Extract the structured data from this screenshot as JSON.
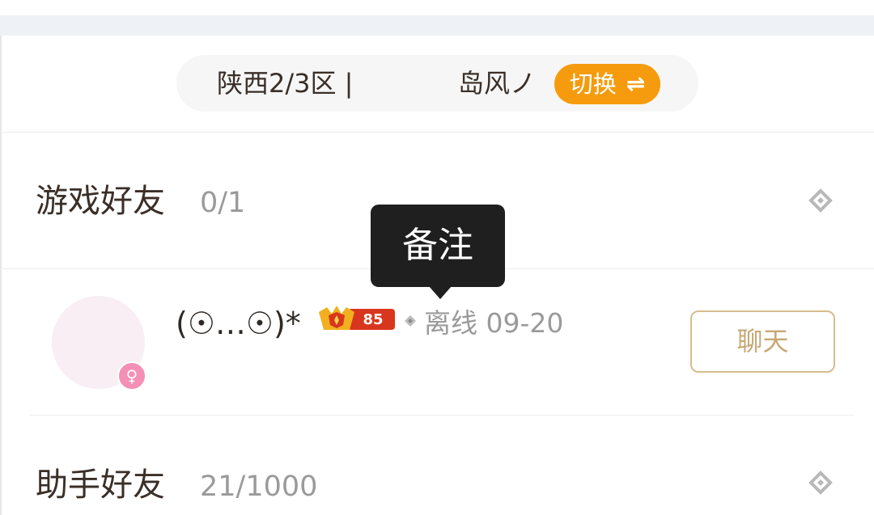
{
  "server_bar": {
    "server": "陕西2/3区 |",
    "role": "岛风ノ",
    "switch_label": "切换",
    "switch_icon": "⇌"
  },
  "game_friends": {
    "title": "游戏好友",
    "count": "0/1",
    "toggle_icon": "diamond-collapse-icon"
  },
  "tooltip": {
    "text": "备注"
  },
  "friend": {
    "name": "(☉…☉)*",
    "gender_icon": "♀",
    "rank_level": "85",
    "status": "离线 09-20",
    "chat_label": "聊天"
  },
  "assistant_friends": {
    "title": "助手好友",
    "count": "21/1000",
    "toggle_icon": "diamond-collapse-icon"
  },
  "colors": {
    "accent": "#f59b0d",
    "chat_border": "#d6bd8f",
    "female": "#f48fb5",
    "rank_red": "#d8361e",
    "rank_gold": "#f2b01e"
  }
}
